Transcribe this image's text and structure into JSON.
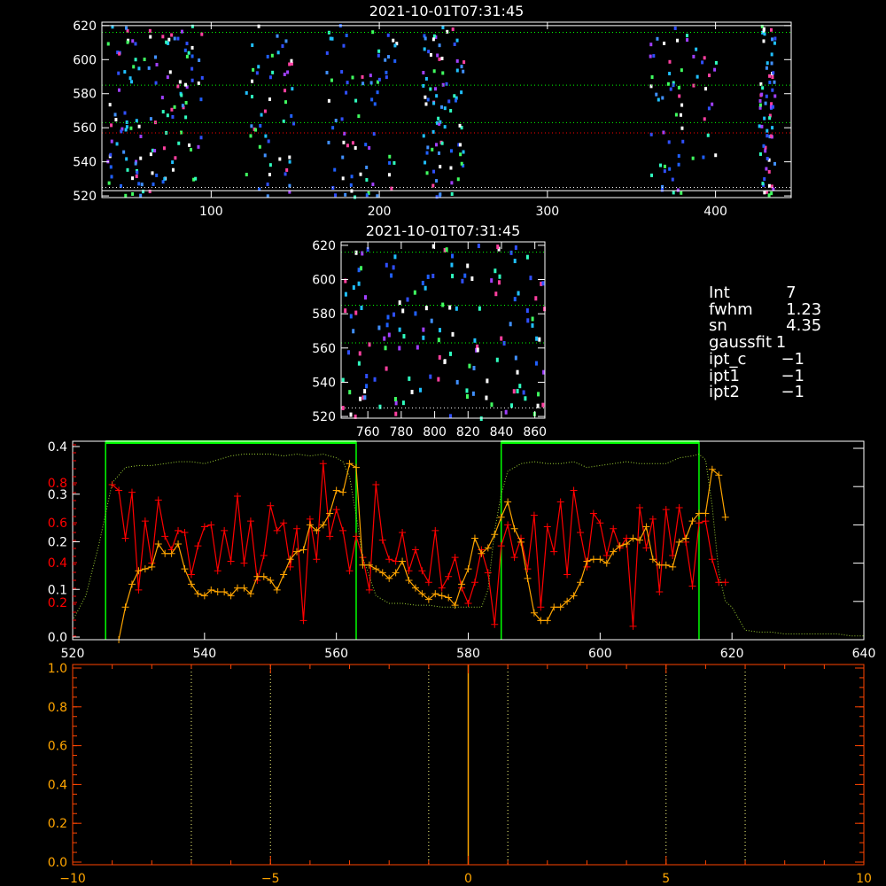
{
  "info": {
    "rows": [
      {
        "key": "Int",
        "val": "   7"
      },
      {
        "key": "fwhm",
        "val": "   1.23"
      },
      {
        "key": "sn",
        "val": "   4.35"
      },
      {
        "key": "gaussfit",
        "val": " 1"
      },
      {
        "key": "ipt_c",
        "val": "  −1"
      },
      {
        "key": "ipt1",
        "val": "  −1"
      },
      {
        "key": "ipt2",
        "val": "  −1"
      }
    ]
  },
  "colors": {
    "frame": "#ffffff",
    "red": "#ff0000",
    "orange": "#ffa500",
    "green": "#00ff00",
    "dotted_green": "#9acd32",
    "bottom_axis": "#ff4500"
  },
  "chart_data": [
    {
      "id": "top-image",
      "type": "heatmap",
      "title": "2021-10-01T07:31:45",
      "xlim": [
        35,
        445
      ],
      "ylim": [
        519,
        622
      ],
      "x_ticks": [
        100,
        200,
        300,
        400
      ],
      "y_ticks": [
        520,
        540,
        560,
        580,
        600,
        620
      ],
      "clusters_x": [
        [
          37,
          60
        ],
        [
          62,
          95
        ],
        [
          120,
          150
        ],
        [
          168,
          210
        ],
        [
          225,
          250
        ],
        [
          360,
          400
        ],
        [
          425,
          435
        ]
      ],
      "guide_lines_y": [
        {
          "y": 620,
          "style": "solid",
          "color": "white"
        },
        {
          "y": 616,
          "style": "dotted",
          "color": "green"
        },
        {
          "y": 585,
          "style": "dotted",
          "color": "green"
        },
        {
          "y": 563,
          "style": "dotted",
          "color": "green"
        },
        {
          "y": 557,
          "style": "dotted",
          "color": "red"
        },
        {
          "y": 525,
          "style": "dotted",
          "color": "white"
        },
        {
          "y": 523,
          "style": "solid",
          "color": "white"
        }
      ]
    },
    {
      "id": "zoom-image",
      "type": "heatmap",
      "title": "2021-10-01T07:31:45",
      "xlim": [
        744,
        866
      ],
      "ylim": [
        519,
        622
      ],
      "x_ticks": [
        760,
        780,
        800,
        820,
        840,
        860
      ],
      "y_ticks": [
        520,
        540,
        560,
        580,
        600,
        620
      ],
      "guide_lines_y": [
        {
          "y": 616,
          "style": "dotted",
          "color": "green"
        },
        {
          "y": 585,
          "style": "dotted",
          "color": "green"
        },
        {
          "y": 563,
          "style": "dotted",
          "color": "green"
        },
        {
          "y": 525,
          "style": "dotted",
          "color": "white"
        }
      ]
    },
    {
      "id": "profile",
      "type": "line",
      "xlim": [
        520,
        640
      ],
      "ylim": [
        0,
        1
      ],
      "x_ticks": [
        520,
        540,
        560,
        580,
        600,
        620,
        640
      ],
      "left_axis_white": [
        "0.0",
        "0.1",
        "0.2",
        "0.3",
        "0.4"
      ],
      "left_axis_white_values": [
        0,
        0.1,
        0.2,
        0.3,
        0.4
      ],
      "left_axis_red": [
        "0.2",
        "0.4",
        "0.6",
        "0.8"
      ],
      "left_axis_red_values": [
        0.2,
        0.4,
        0.6,
        0.8
      ],
      "boxes": [
        {
          "x0": 525,
          "x1": 563
        },
        {
          "x0": 585,
          "x1": 615
        }
      ],
      "series": [
        {
          "color": "red",
          "x": [
            526,
            527,
            528,
            529,
            530,
            531,
            532,
            533,
            534,
            535,
            536,
            537,
            538,
            539,
            540,
            541,
            542,
            543,
            544,
            545,
            546,
            547,
            548,
            549,
            550,
            551,
            552,
            553,
            554,
            555,
            556,
            557,
            558,
            559,
            560,
            561,
            562,
            563,
            564,
            565,
            566,
            567,
            568,
            569,
            570,
            571,
            572,
            573,
            574,
            575,
            576,
            577,
            578,
            579,
            580,
            581,
            582,
            583,
            584,
            585,
            586,
            587,
            588,
            589,
            590,
            591,
            592,
            593,
            594,
            595,
            596,
            597,
            598,
            599,
            600,
            601,
            602,
            603,
            604,
            605,
            606,
            607,
            608,
            609,
            610,
            611,
            612,
            613,
            614,
            615,
            616,
            617,
            618,
            619
          ],
          "y": [
            0.81,
            0.78,
            0.53,
            0.77,
            0.26,
            0.62,
            0.4,
            0.73,
            0.54,
            0.47,
            0.57,
            0.56,
            0.34,
            0.49,
            0.59,
            0.6,
            0.36,
            0.57,
            0.41,
            0.75,
            0.4,
            0.62,
            0.31,
            0.44,
            0.7,
            0.57,
            0.61,
            0.38,
            0.58,
            0.1,
            0.63,
            0.42,
            0.92,
            0.54,
            0.68,
            0.57,
            0.36,
            0.54,
            0.43,
            0.26,
            0.81,
            0.52,
            0.42,
            0.41,
            0.56,
            0.36,
            0.47,
            0.36,
            0.3,
            0.57,
            0.27,
            0.33,
            0.43,
            0.27,
            0.19,
            0.3,
            0.47,
            0.35,
            0.08,
            0.49,
            0.6,
            0.43,
            0.53,
            0.37,
            0.65,
            0.17,
            0.59,
            0.46,
            0.72,
            0.34,
            0.78,
            0.56,
            0.38,
            0.66,
            0.61,
            0.44,
            0.58,
            0.48,
            0.53,
            0.07,
            0.69,
            0.48,
            0.63,
            0.25,
            0.68,
            0.44,
            0.69,
            0.51,
            0.28,
            0.61,
            0.62,
            0.42,
            0.3,
            0.3
          ]
        },
        {
          "color": "orange",
          "x": [
            527,
            528,
            529,
            530,
            531,
            532,
            533,
            534,
            535,
            536,
            537,
            538,
            539,
            540,
            541,
            542,
            543,
            544,
            545,
            546,
            547,
            548,
            549,
            550,
            551,
            552,
            553,
            554,
            555,
            556,
            557,
            558,
            559,
            560,
            561,
            562,
            563,
            564,
            565,
            566,
            567,
            568,
            569,
            570,
            571,
            572,
            573,
            574,
            575,
            576,
            577,
            578,
            579,
            580,
            581,
            582,
            583,
            584,
            585,
            586,
            587,
            588,
            589,
            590,
            591,
            592,
            593,
            594,
            595,
            596,
            597,
            598,
            599,
            600,
            601,
            602,
            603,
            604,
            605,
            606,
            607,
            608,
            609,
            610,
            611,
            612,
            613,
            614,
            615,
            616,
            617,
            618,
            619
          ],
          "y": [
            0.0,
            0.17,
            0.29,
            0.36,
            0.37,
            0.38,
            0.5,
            0.45,
            0.45,
            0.5,
            0.37,
            0.29,
            0.24,
            0.23,
            0.26,
            0.25,
            0.25,
            0.23,
            0.27,
            0.27,
            0.24,
            0.33,
            0.33,
            0.31,
            0.26,
            0.34,
            0.42,
            0.46,
            0.47,
            0.6,
            0.57,
            0.6,
            0.66,
            0.78,
            0.77,
            0.92,
            0.9,
            0.39,
            0.39,
            0.37,
            0.35,
            0.32,
            0.35,
            0.41,
            0.31,
            0.27,
            0.24,
            0.21,
            0.24,
            0.23,
            0.22,
            0.18,
            0.29,
            0.37,
            0.53,
            0.45,
            0.48,
            0.55,
            0.64,
            0.72,
            0.58,
            0.51,
            0.32,
            0.14,
            0.1,
            0.1,
            0.17,
            0.17,
            0.2,
            0.23,
            0.3,
            0.41,
            0.42,
            0.42,
            0.4,
            0.46,
            0.49,
            0.5,
            0.53,
            0.52,
            0.59,
            0.42,
            0.39,
            0.39,
            0.38,
            0.51,
            0.53,
            0.62,
            0.66,
            0.66,
            0.89,
            0.86,
            0.64
          ]
        },
        {
          "color": "dotted_green",
          "x": [
            520,
            522,
            524,
            526,
            528,
            530,
            532,
            534,
            536,
            538,
            540,
            542,
            544,
            546,
            548,
            550,
            552,
            554,
            556,
            558,
            560,
            561,
            562,
            563,
            564,
            565,
            566,
            568,
            570,
            572,
            574,
            576,
            578,
            580,
            582,
            583,
            584,
            585,
            586,
            588,
            590,
            592,
            594,
            596,
            598,
            600,
            602,
            604,
            606,
            608,
            610,
            612,
            614,
            615,
            616,
            617,
            618,
            619,
            620,
            622,
            624,
            626,
            628,
            630,
            632,
            634,
            636,
            638,
            640
          ],
          "y": [
            0.1,
            0.23,
            0.5,
            0.82,
            0.9,
            0.91,
            0.91,
            0.92,
            0.93,
            0.93,
            0.92,
            0.94,
            0.96,
            0.97,
            0.97,
            0.97,
            0.96,
            0.97,
            0.96,
            0.97,
            0.95,
            0.93,
            0.85,
            0.65,
            0.43,
            0.33,
            0.23,
            0.19,
            0.19,
            0.18,
            0.18,
            0.17,
            0.17,
            0.17,
            0.17,
            0.26,
            0.57,
            0.76,
            0.88,
            0.92,
            0.93,
            0.92,
            0.92,
            0.93,
            0.9,
            0.91,
            0.92,
            0.93,
            0.92,
            0.92,
            0.92,
            0.95,
            0.96,
            0.97,
            0.94,
            0.7,
            0.35,
            0.2,
            0.17,
            0.05,
            0.04,
            0.04,
            0.03,
            0.03,
            0.03,
            0.03,
            0.03,
            0.02,
            0.02
          ]
        }
      ]
    },
    {
      "id": "bottom-plot",
      "type": "line",
      "xlim": [
        -10,
        10
      ],
      "ylim": [
        0,
        1
      ],
      "x_ticks": [
        -10,
        -5,
        0,
        5,
        10
      ],
      "y_ticks": [
        0.0,
        0.2,
        0.4,
        0.6,
        0.8,
        1.0
      ],
      "y_tick_labels": [
        "0.0",
        "0.2",
        "0.4",
        "0.6",
        "0.8",
        "1.0"
      ],
      "x_tick_labels": [
        "−10",
        "−5",
        "0",
        "5",
        "10"
      ],
      "dotted_verticals": [
        -7,
        -5,
        -1,
        1,
        5,
        7
      ],
      "solid_vertical": 0
    }
  ]
}
